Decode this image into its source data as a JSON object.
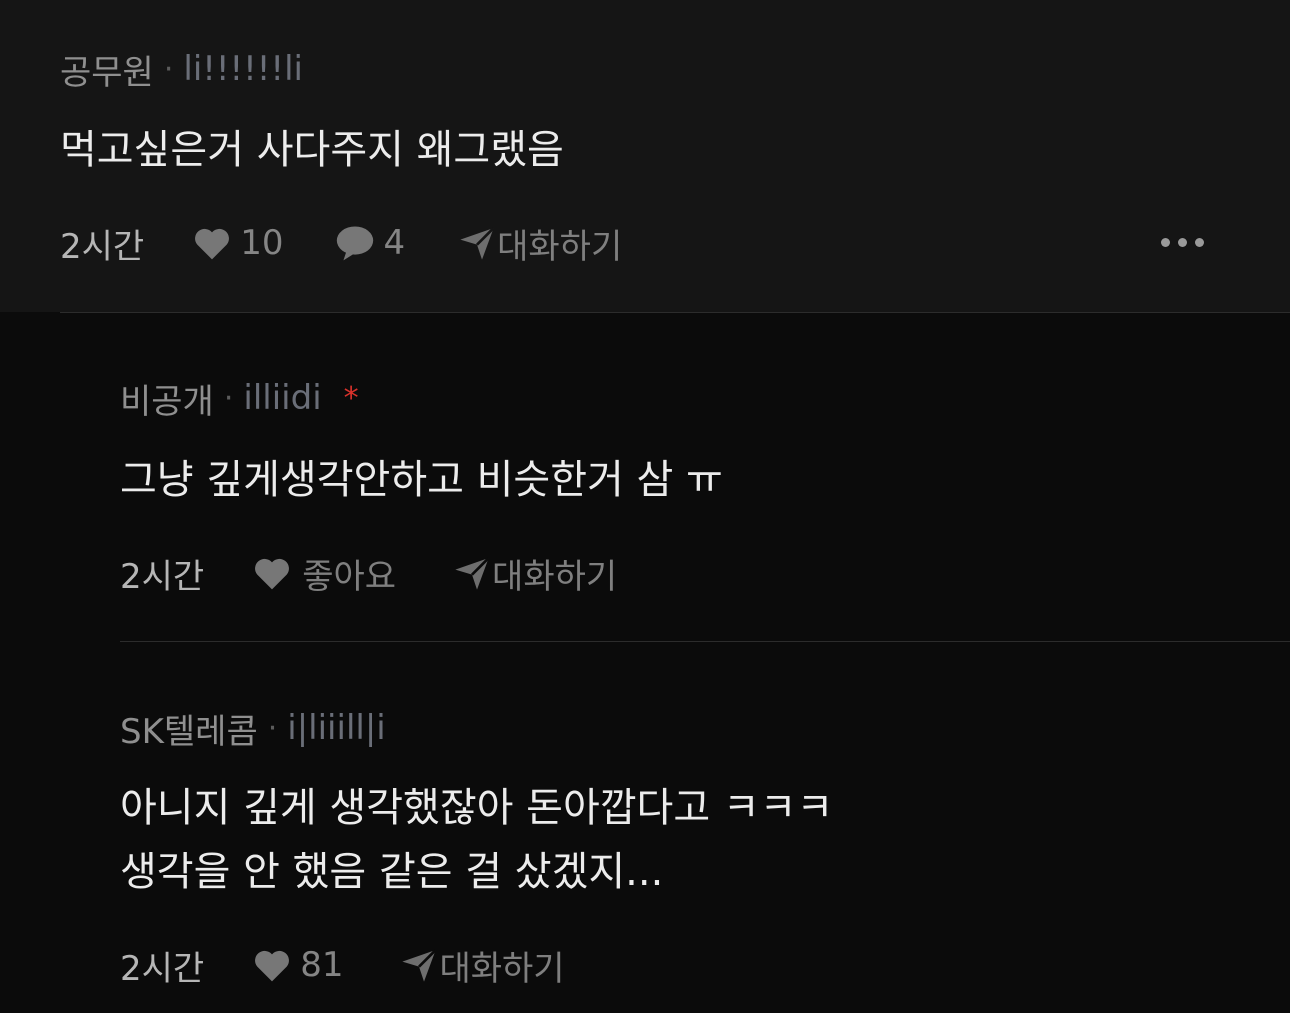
{
  "comments": [
    {
      "author": "공무원",
      "separator": "·",
      "handle": "li!!!!!!li",
      "text": "먹고싶은거 사다주지 왜그랬음",
      "time": "2시간",
      "likes": "10",
      "replies": "4",
      "chat_label": "대화하기",
      "more_icon": "more-horizontal-icon"
    },
    {
      "author": "비공개",
      "separator": "·",
      "handle": "illiidi",
      "marker": "*",
      "text": "그냥 깊게생각안하고 비슷한거 삼 ㅠ",
      "time": "2시간",
      "like_label": "좋아요",
      "chat_label": "대화하기"
    },
    {
      "author": "SK텔레콤",
      "separator": "·",
      "handle": "i|liiill|i",
      "text_lines": [
        "아니지 깊게 생각했잖아 돈아깝다고 ㅋㅋㅋ",
        "생각을 안 했음 같은 걸 샀겠지..."
      ],
      "time": "2시간",
      "likes": "81",
      "chat_label": "대화하기"
    }
  ],
  "colors": {
    "background": "#0b0b0b",
    "top_comment_bg": "#151515",
    "text": "#ececec",
    "muted": "#8f8f8f",
    "accent_red": "#d9322b"
  }
}
